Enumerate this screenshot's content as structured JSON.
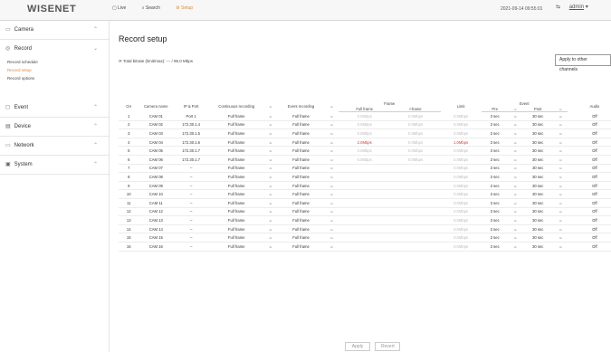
{
  "app": {
    "logo": "WISENET"
  },
  "topnav": {
    "live": "Live",
    "search": "Search",
    "setup": "Setup"
  },
  "header": {
    "datetime": "2021-09-14 09:55:01",
    "user": "admin"
  },
  "sidebar": {
    "items": [
      {
        "label": "Camera",
        "icon": "camera-icon"
      },
      {
        "label": "Record",
        "icon": "record-icon",
        "subitems": [
          "Record schedule",
          "Record setup",
          "Record options"
        ]
      },
      {
        "label": "Event",
        "icon": "event-icon"
      },
      {
        "label": "Device",
        "icon": "device-icon"
      },
      {
        "label": "Network",
        "icon": "network-icon"
      },
      {
        "label": "System",
        "icon": "system-icon"
      }
    ]
  },
  "main": {
    "title": "Record setup",
    "total_label": "Total bitrate (limit/max):",
    "total_value": "--- / 96.0 Mbps",
    "apply_other": "Apply to other channels"
  },
  "table": {
    "headers": {
      "ch": "CH",
      "camera": "Camera name",
      "ip": "IP & Port",
      "continuous": "Continuous recording",
      "event": "Event recording",
      "frame": "Frame",
      "fullframe": "Full frame",
      "iframe": "I-frame",
      "limit": "Limit",
      "event_group": "Event",
      "pre": "Pre",
      "post": "Post",
      "audio": "Audio"
    },
    "rows": [
      {
        "ch": "1",
        "name": "CAM 01",
        "ip": "Port 1",
        "cont": "Full frame",
        "ev": "Full frame",
        "ff": "0.0Mbps",
        "if": "0.0Mbps",
        "lim": "0.0Mbps",
        "pre": "3 sec",
        "post": "30 sec",
        "aud": "Off"
      },
      {
        "ch": "2",
        "name": "CAM 02",
        "ip": "172.30.1.4",
        "cont": "Full frame",
        "ev": "Full frame",
        "ff": "0.0Mbps",
        "if": "0.0Mbps",
        "lim": "0.0Mbps",
        "pre": "3 sec",
        "post": "30 sec",
        "aud": "Off"
      },
      {
        "ch": "3",
        "name": "CAM 03",
        "ip": "172.30.1.5",
        "cont": "Full frame",
        "ev": "Full frame",
        "ff": "0.0Mbps",
        "if": "0.0Mbps",
        "lim": "0.0Mbps",
        "pre": "3 sec",
        "post": "30 sec",
        "aud": "Off"
      },
      {
        "ch": "4",
        "name": "CAM 04",
        "ip": "172.30.1.6",
        "cont": "Full frame",
        "ev": "Full frame",
        "ff": "2.0Mbps",
        "if": "0.0Mbps",
        "lim": "1.0Mbps",
        "pre": "3 sec",
        "post": "30 sec",
        "aud": "Off"
      },
      {
        "ch": "5",
        "name": "CAM 05",
        "ip": "172.30.1.7",
        "cont": "Full frame",
        "ev": "Full frame",
        "ff": "0.0Mbps",
        "if": "0.0Mbps",
        "lim": "0.0Mbps",
        "pre": "3 sec",
        "post": "30 sec",
        "aud": "Off"
      },
      {
        "ch": "6",
        "name": "CAM 06",
        "ip": "172.30.1.7",
        "cont": "Full frame",
        "ev": "Full frame",
        "ff": "0.0Mbps",
        "if": "0.0Mbps",
        "lim": "0.0Mbps",
        "pre": "3 sec",
        "post": "30 sec",
        "aud": "Off"
      },
      {
        "ch": "7",
        "name": "CAM 07",
        "ip": "--",
        "cont": "Full frame",
        "ev": "Full frame",
        "ff": "",
        "if": "",
        "lim": "0.0Mbps",
        "pre": "3 sec",
        "post": "30 sec",
        "aud": "Off"
      },
      {
        "ch": "8",
        "name": "CAM 08",
        "ip": "--",
        "cont": "Full frame",
        "ev": "Full frame",
        "ff": "",
        "if": "",
        "lim": "0.0Mbps",
        "pre": "3 sec",
        "post": "30 sec",
        "aud": "Off"
      },
      {
        "ch": "9",
        "name": "CAM 09",
        "ip": "--",
        "cont": "Full frame",
        "ev": "Full frame",
        "ff": "",
        "if": "",
        "lim": "0.0Mbps",
        "pre": "3 sec",
        "post": "30 sec",
        "aud": "Off"
      },
      {
        "ch": "10",
        "name": "CAM 10",
        "ip": "--",
        "cont": "Full frame",
        "ev": "Full frame",
        "ff": "",
        "if": "",
        "lim": "0.0Mbps",
        "pre": "3 sec",
        "post": "30 sec",
        "aud": "Off"
      },
      {
        "ch": "11",
        "name": "CAM 11",
        "ip": "--",
        "cont": "Full frame",
        "ev": "Full frame",
        "ff": "",
        "if": "",
        "lim": "0.0Mbps",
        "pre": "3 sec",
        "post": "30 sec",
        "aud": "Off"
      },
      {
        "ch": "12",
        "name": "CAM 12",
        "ip": "--",
        "cont": "Full frame",
        "ev": "Full frame",
        "ff": "",
        "if": "",
        "lim": "0.0Mbps",
        "pre": "3 sec",
        "post": "30 sec",
        "aud": "Off"
      },
      {
        "ch": "13",
        "name": "CAM 13",
        "ip": "--",
        "cont": "Full frame",
        "ev": "Full frame",
        "ff": "",
        "if": "",
        "lim": "0.0Mbps",
        "pre": "3 sec",
        "post": "30 sec",
        "aud": "Off"
      },
      {
        "ch": "14",
        "name": "CAM 14",
        "ip": "--",
        "cont": "Full frame",
        "ev": "Full frame",
        "ff": "",
        "if": "",
        "lim": "0.0Mbps",
        "pre": "3 sec",
        "post": "30 sec",
        "aud": "Off"
      },
      {
        "ch": "15",
        "name": "CAM 15",
        "ip": "--",
        "cont": "Full frame",
        "ev": "Full frame",
        "ff": "",
        "if": "",
        "lim": "0.0Mbps",
        "pre": "3 sec",
        "post": "30 sec",
        "aud": "Off"
      },
      {
        "ch": "16",
        "name": "CAM 16",
        "ip": "--",
        "cont": "Full frame",
        "ev": "Full frame",
        "ff": "",
        "if": "",
        "lim": "0.0Mbps",
        "pre": "3 sec",
        "post": "30 sec",
        "aud": "Off"
      }
    ]
  },
  "footer": {
    "apply": "Apply",
    "revert": "Revert"
  },
  "colors": {
    "accent": "#e08a3a",
    "warning": "#d23a3a"
  }
}
